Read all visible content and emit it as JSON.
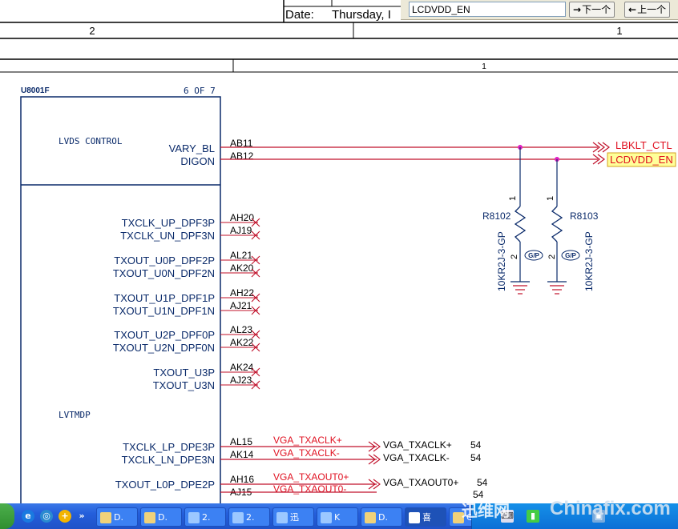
{
  "title_block": {
    "date_label": "Date:",
    "date_value": "Thursday, I",
    "zone_left": "2",
    "zone_right": "1",
    "zone_top": "1"
  },
  "find_bar": {
    "query": "LCDVDD_EN",
    "next_label": "下一个",
    "prev_label": "上一个"
  },
  "schematic": {
    "ref": "U8001F",
    "sheet": "6 OF 7",
    "group_lvds": "LVDS CONTROL",
    "group_lvtmdp": "LVTMDP",
    "control_pins": [
      {
        "name": "VARY_BL",
        "pin": "AB11"
      },
      {
        "name": "DIGON",
        "pin": "AB12"
      }
    ],
    "ports": {
      "lbklt": "LBKLT_CTL",
      "lcdvdd": "LCDVDD_EN"
    },
    "nc_pins": [
      {
        "name": "TXCLK_UP_DPF3P",
        "pin": "AH20"
      },
      {
        "name": "TXCLK_UN_DPF3N",
        "pin": "AJ19"
      },
      {
        "name": "TXOUT_U0P_DPF2P",
        "pin": "AL21"
      },
      {
        "name": "TXOUT_U0N_DPF2N",
        "pin": "AK20"
      },
      {
        "name": "TXOUT_U1P_DPF1P",
        "pin": "AH22"
      },
      {
        "name": "TXOUT_U1N_DPF1N",
        "pin": "AJ21"
      },
      {
        "name": "TXOUT_U2P_DPF0P",
        "pin": "AL23"
      },
      {
        "name": "TXOUT_U2N_DPF0N",
        "pin": "AK22"
      },
      {
        "name": "TXOUT_U3P",
        "pin": "AK24"
      },
      {
        "name": "TXOUT_U3N",
        "pin": "AJ23"
      }
    ],
    "vga_pins": [
      {
        "name": "TXCLK_LP_DPE3P",
        "pin": "AL15",
        "net": "VGA_TXACLK+",
        "off": "VGA_TXACLK+",
        "page": "54"
      },
      {
        "name": "TXCLK_LN_DPE3N",
        "pin": "AK14",
        "net": "VGA_TXACLK-",
        "off": "VGA_TXACLK-",
        "page": "54"
      },
      {
        "name": "TXOUT_L0P_DPE2P",
        "pin": "AH16",
        "net": "VGA_TXAOUT0+",
        "off": "VGA_TXAOUT0+",
        "page": "54"
      }
    ],
    "partial_row": {
      "pin": "AJ15",
      "net": "VGA_TXAOUT0-",
      "page": "54"
    },
    "resistors": [
      {
        "ref": "R8102",
        "value": "10KR2J-3-GP",
        "pin1": "1",
        "pin2": "2",
        "mark": "G/P"
      },
      {
        "ref": "R8103",
        "value": "10KR2J-3-GP",
        "pin1": "1",
        "pin2": "2",
        "mark": "G/P"
      }
    ]
  },
  "taskbar": {
    "buttons": [
      "D.",
      "D.",
      "2.",
      "2.",
      "迅",
      "K",
      "D.",
      "喜",
      "C."
    ],
    "watermark_left": "迅维网",
    "watermark_right": "Chinafix.com"
  },
  "colors": {
    "net": "#c0102a",
    "text": "#0a2a6a",
    "port": "#e01020",
    "highlight": "#ffff99",
    "junction": "#e020c0"
  }
}
